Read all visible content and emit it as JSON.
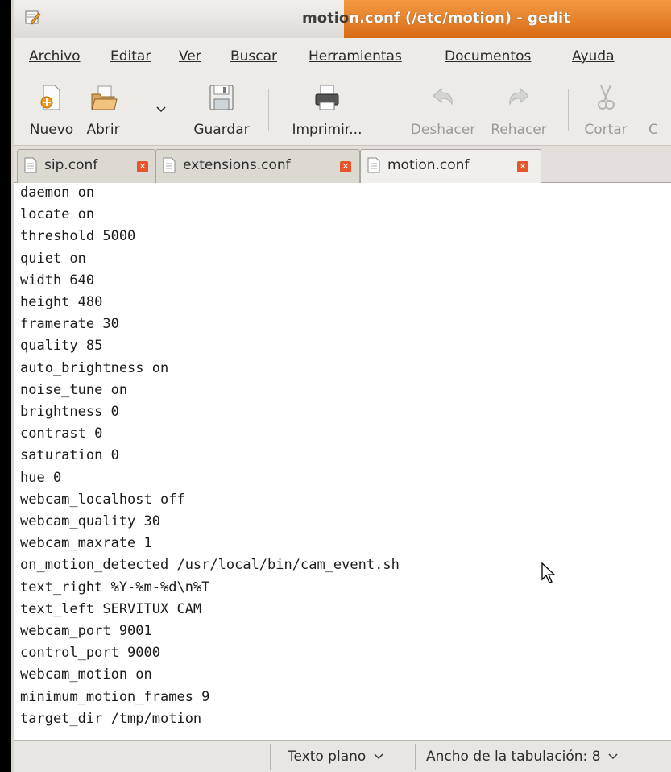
{
  "window": {
    "title_pre": "motio",
    "title_post": "n.conf (/etc/motion) - gedit"
  },
  "menu": [
    {
      "label": "Archivo"
    },
    {
      "label": "Editar"
    },
    {
      "label": "Ver"
    },
    {
      "label": "Buscar"
    },
    {
      "label": "Herramientas"
    },
    {
      "label": "Documentos"
    },
    {
      "label": "Ayuda"
    }
  ],
  "toolbar": {
    "new_label": "Nuevo",
    "open_label": "Abrir",
    "save_label": "Guardar",
    "print_label": "Imprimir...",
    "undo_label": "Deshacer",
    "redo_label": "Rehacer",
    "cut_label": "Cortar",
    "copy_label": "C"
  },
  "tabs": [
    {
      "label": "sip.conf"
    },
    {
      "label": "extensions.conf"
    },
    {
      "label": "motion.conf"
    }
  ],
  "editor": {
    "lines": [
      "daemon on",
      "locate on",
      "threshold 5000",
      "quiet on",
      "width 640",
      "height 480",
      "framerate 30",
      "quality 85",
      "auto_brightness on",
      "noise_tune on",
      "brightness 0",
      "contrast 0",
      "saturation 0",
      "hue 0",
      "webcam_localhost off",
      "webcam_quality 30",
      "webcam_maxrate 1",
      "on_motion_detected /usr/local/bin/cam_event.sh",
      "text_right %Y-%m-%d\\n%T",
      "text_left SERVITUX CAM",
      "webcam_port 9001",
      "control_port 9000",
      "webcam_motion on",
      "minimum_motion_frames 9",
      "target_dir /tmp/motion"
    ]
  },
  "status": {
    "language": "Texto plano",
    "tab_width": "Ancho de la tabulación: 8"
  },
  "colors": {
    "title_accent": "#e07820",
    "close_tab": "#e8542a"
  }
}
